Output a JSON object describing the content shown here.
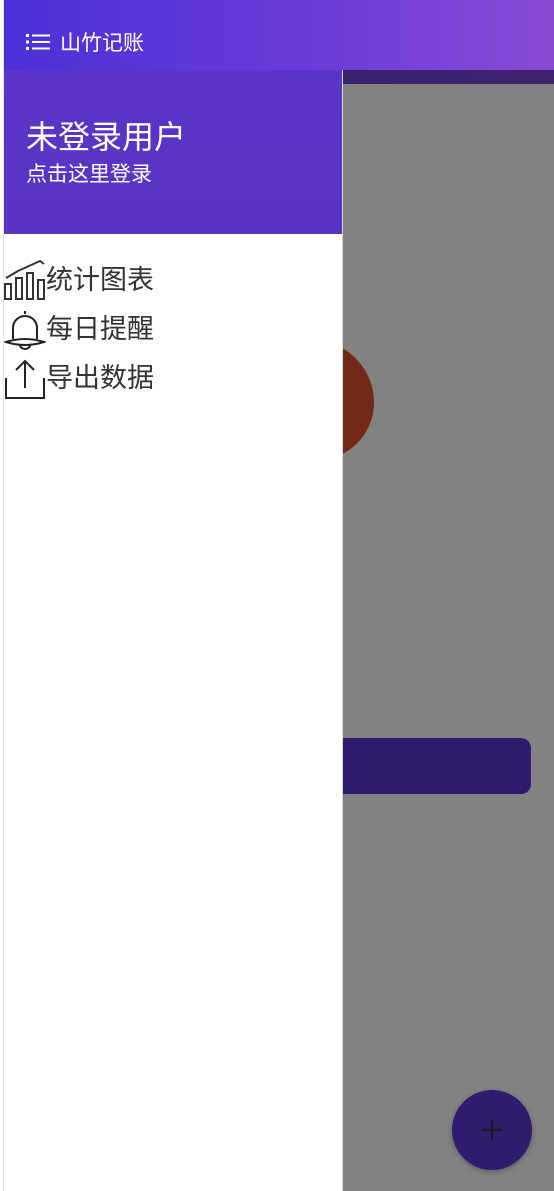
{
  "app_bar": {
    "title": "山竹记账",
    "menu_icon": "menu-list-icon"
  },
  "drawer": {
    "user_name": "未登录用户",
    "login_hint": "点击这里登录",
    "items": [
      {
        "label": "统计图表",
        "icon": "bar-chart-icon"
      },
      {
        "label": "每日提醒",
        "icon": "bell-icon"
      },
      {
        "label": "导出数据",
        "icon": "upload-icon"
      }
    ]
  },
  "fab": {
    "icon": "plus-icon"
  },
  "colors": {
    "primary": "#5a37d8",
    "header_gradient_start": "#4b31d7",
    "header_gradient_end": "#8a4bd6",
    "scrim": "rgba(0,0,0,0.49)"
  }
}
